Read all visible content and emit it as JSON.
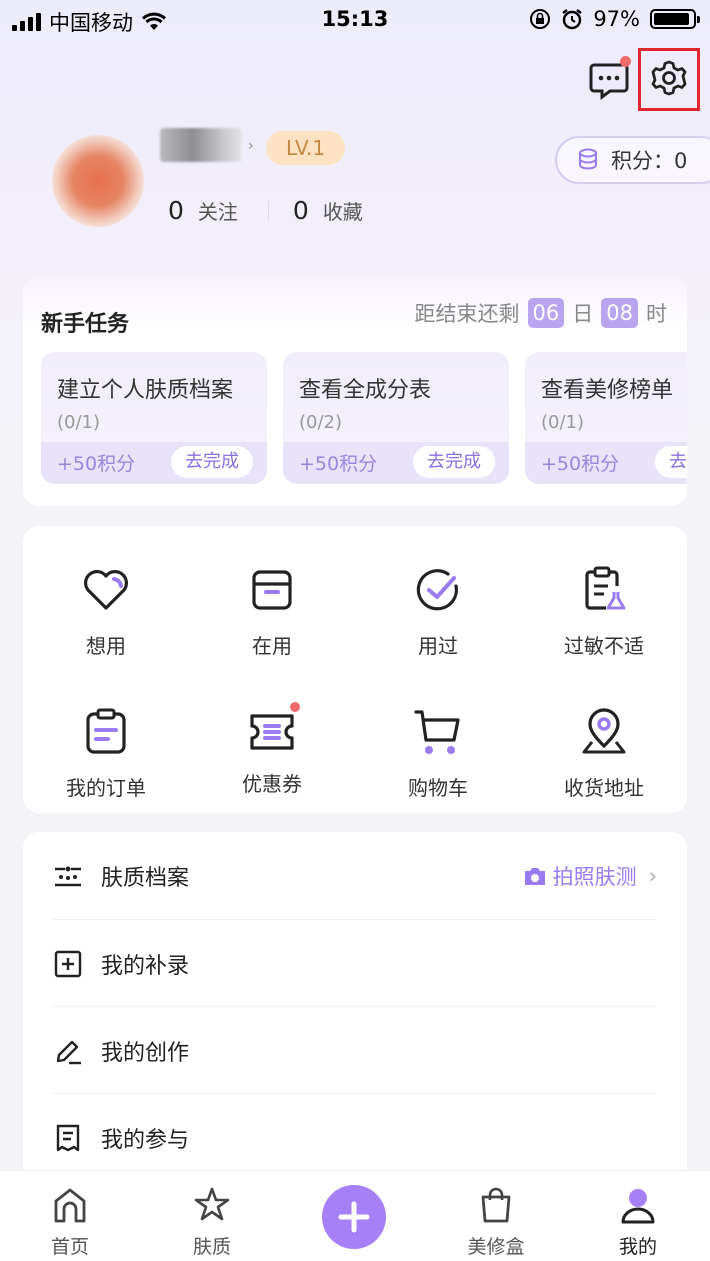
{
  "status_bar": {
    "carrier": "中国移动",
    "time": "15:13",
    "battery": "97%"
  },
  "header": {
    "message_icon": "message-icon",
    "settings_icon": "gear-icon",
    "highlight_color": "#e0262f"
  },
  "profile": {
    "level": "LV.1",
    "following_count": "0",
    "following_label": "关注",
    "favorites_count": "0",
    "favorites_label": "收藏",
    "points_label": "积分：0"
  },
  "tasks": {
    "title": "新手任务",
    "countdown_prefix": "距结束还剩",
    "days": "06",
    "day_unit": "日",
    "hours": "08",
    "hour_unit": "时",
    "items": [
      {
        "name": "建立个人肤质档案",
        "progress": "(0/1)",
        "points": "+50积分",
        "action": "去完成"
      },
      {
        "name": "查看全成分表",
        "progress": "(0/2)",
        "points": "+50积分",
        "action": "去完成"
      },
      {
        "name": "查看美修榜单",
        "progress": "(0/1)",
        "points": "+50积分",
        "action": "去完成"
      }
    ]
  },
  "grid": {
    "items": [
      {
        "label": "想用",
        "icon": "heart-icon"
      },
      {
        "label": "在用",
        "icon": "box-icon"
      },
      {
        "label": "用过",
        "icon": "check-circle-icon"
      },
      {
        "label": "过敏不适",
        "icon": "clipboard-flask-icon"
      },
      {
        "label": "我的订单",
        "icon": "order-icon"
      },
      {
        "label": "优惠券",
        "icon": "coupon-icon"
      },
      {
        "label": "购物车",
        "icon": "cart-icon"
      },
      {
        "label": "收货地址",
        "icon": "location-pin-icon"
      }
    ]
  },
  "menu": {
    "items": [
      {
        "label": "肤质档案",
        "icon": "skin-profile-icon"
      },
      {
        "label": "我的补录",
        "icon": "plus-square-icon"
      },
      {
        "label": "我的创作",
        "icon": "pencil-icon"
      },
      {
        "label": "我的参与",
        "icon": "document-icon"
      }
    ],
    "scan_link": "拍照肤测"
  },
  "bottom_nav": {
    "items": [
      {
        "label": "首页",
        "icon": "home-icon"
      },
      {
        "label": "肤质",
        "icon": "star-icon"
      },
      {
        "label": "美修盒",
        "icon": "bag-icon"
      },
      {
        "label": "我的",
        "icon": "user-icon"
      }
    ]
  },
  "colors": {
    "accent": "#a580f6",
    "badge": "#fbe2c2",
    "dot": "#f06a6a"
  }
}
